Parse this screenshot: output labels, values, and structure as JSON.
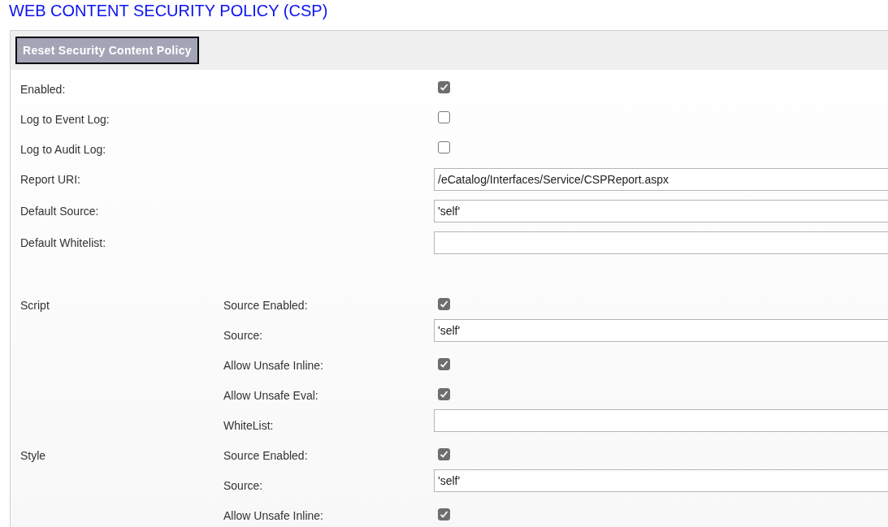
{
  "title": "WEB CONTENT SECURITY POLICY (CSP)",
  "reset_button": "Reset Security Content Policy",
  "general": [
    {
      "label": "Enabled:",
      "kind": "checkbox",
      "checked": true
    },
    {
      "label": "Log to Event Log:",
      "kind": "checkbox",
      "checked": false
    },
    {
      "label": "Log to Audit Log:",
      "kind": "checkbox",
      "checked": false
    },
    {
      "label": "Report URI:",
      "kind": "text",
      "value": "/eCatalog/Interfaces/Service/CSPReport.aspx"
    },
    {
      "label": "Default Source:",
      "kind": "text",
      "value": "'self'"
    },
    {
      "label": "Default Whitelist:",
      "kind": "text"
    }
  ],
  "groups": [
    {
      "name": "Script",
      "fields": [
        {
          "label": "Source Enabled:",
          "kind": "checkbox",
          "checked": true
        },
        {
          "label": "Source:",
          "kind": "text",
          "value": "'self'"
        },
        {
          "label": "Allow Unsafe Inline:",
          "kind": "checkbox",
          "checked": true
        },
        {
          "label": "Allow Unsafe Eval:",
          "kind": "checkbox",
          "checked": true
        },
        {
          "label": "WhiteList:",
          "kind": "text"
        }
      ]
    },
    {
      "name": "Style",
      "fields": [
        {
          "label": "Source Enabled:",
          "kind": "checkbox",
          "checked": true
        },
        {
          "label": "Source:",
          "kind": "text",
          "value": "'self'"
        },
        {
          "label": "Allow Unsafe Inline:",
          "kind": "checkbox",
          "checked": true
        }
      ]
    }
  ]
}
